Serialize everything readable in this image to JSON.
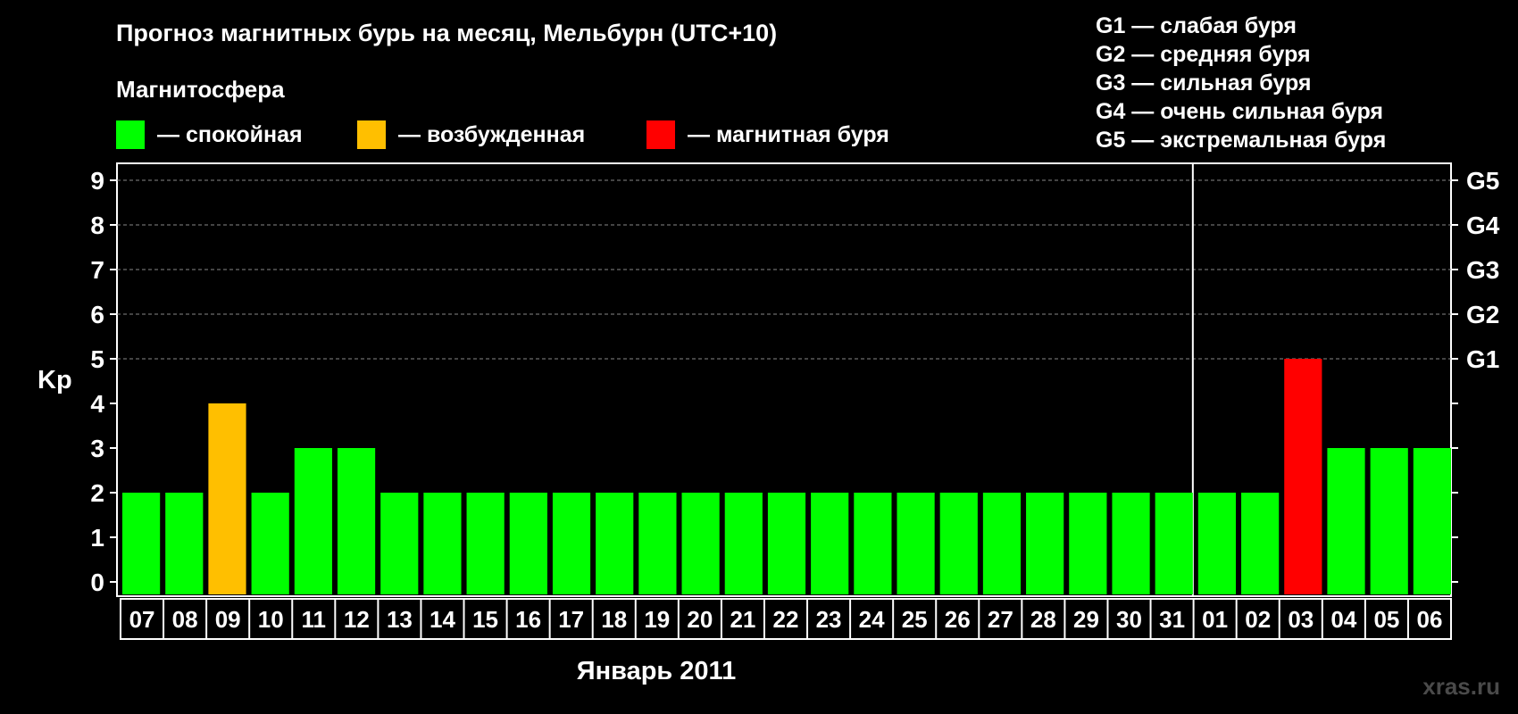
{
  "title": "Прогноз магнитных бурь на месяц, Мельбурн (UTC+10)",
  "subtitle": "Магнитосфера",
  "legend": [
    {
      "label": "— спокойная",
      "color": "#00ff00"
    },
    {
      "label": "— возбужденная",
      "color": "#ffbf00"
    },
    {
      "label": "— магнитная буря",
      "color": "#ff0000"
    }
  ],
  "g_legend": [
    "G1 — слабая буря",
    "G2 — средняя буря",
    "G3 — сильная буря",
    "G4 — очень сильная буря",
    "G5 — экстремальная буря"
  ],
  "watermark": "xras.ru",
  "chart_data": {
    "type": "bar",
    "categories": [
      "07",
      "08",
      "09",
      "10",
      "11",
      "12",
      "13",
      "14",
      "15",
      "16",
      "17",
      "18",
      "19",
      "20",
      "21",
      "22",
      "23",
      "24",
      "25",
      "26",
      "27",
      "28",
      "29",
      "30",
      "31",
      "01",
      "02",
      "03",
      "04",
      "05",
      "06"
    ],
    "values": [
      2,
      2,
      4,
      2,
      3,
      3,
      2,
      2,
      2,
      2,
      2,
      2,
      2,
      2,
      2,
      2,
      2,
      2,
      2,
      2,
      2,
      2,
      2,
      2,
      2,
      2,
      2,
      5,
      3,
      3,
      3
    ],
    "colors": [
      "#00ff00",
      "#00ff00",
      "#ffbf00",
      "#00ff00",
      "#00ff00",
      "#00ff00",
      "#00ff00",
      "#00ff00",
      "#00ff00",
      "#00ff00",
      "#00ff00",
      "#00ff00",
      "#00ff00",
      "#00ff00",
      "#00ff00",
      "#00ff00",
      "#00ff00",
      "#00ff00",
      "#00ff00",
      "#00ff00",
      "#00ff00",
      "#00ff00",
      "#00ff00",
      "#00ff00",
      "#00ff00",
      "#00ff00",
      "#00ff00",
      "#ff0000",
      "#00ff00",
      "#00ff00",
      "#00ff00"
    ],
    "xlabel": "Январь 2011",
    "ylabel": "Kp",
    "ylim": [
      0,
      9
    ],
    "yticks": [
      0,
      1,
      2,
      3,
      4,
      5,
      6,
      7,
      8,
      9
    ],
    "right_ticks": [
      {
        "value": 5,
        "label": "G1"
      },
      {
        "value": 6,
        "label": "G2"
      },
      {
        "value": 7,
        "label": "G3"
      },
      {
        "value": 8,
        "label": "G4"
      },
      {
        "value": 9,
        "label": "G5"
      }
    ],
    "month_break_after_index": 24,
    "grid": true
  }
}
